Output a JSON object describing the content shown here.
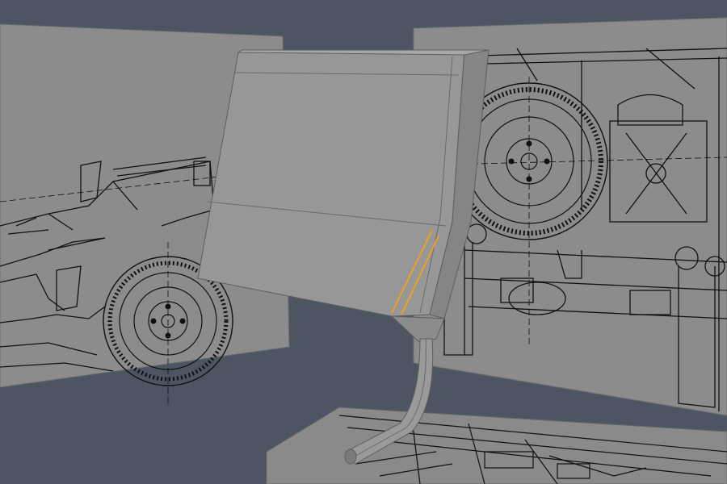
{
  "viewport": {
    "background_color": "#4d5563",
    "panel_color": "#8c8c8c",
    "panel_edge_color": "#6f6f6f",
    "blueprint_line_color": "#111111",
    "model_face_color": "#979797",
    "model_shade_color": "#7f7f7f",
    "model_edge_color": "#5e5e5e",
    "selection_color": "#f0a020"
  },
  "scene": {
    "objects": [
      {
        "kind": "image-plane",
        "view": "side",
        "icon": "blueprint-side-view"
      },
      {
        "kind": "image-plane",
        "view": "rear",
        "icon": "blueprint-rear-view"
      },
      {
        "kind": "image-plane",
        "view": "top",
        "icon": "blueprint-top-view"
      },
      {
        "kind": "mesh",
        "name_hint": "fender-panel",
        "icon": "mesh-panel",
        "selected_edges": 2
      }
    ]
  }
}
